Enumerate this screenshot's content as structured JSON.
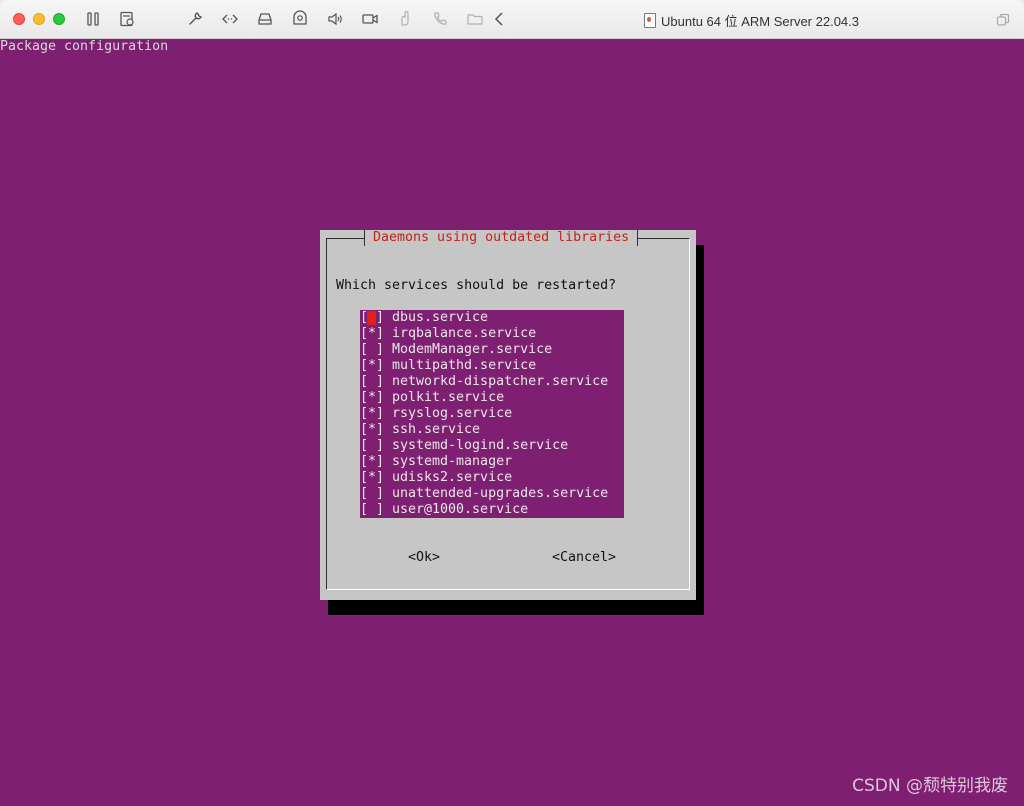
{
  "window": {
    "title": "Ubuntu 64 位 ARM Server 22.04.3"
  },
  "terminal": {
    "header": "Package configuration"
  },
  "dialog": {
    "title": "Daemons using outdated libraries",
    "question": "Which services should be restarted?",
    "services": [
      {
        "box": "[ ]",
        "label": "dbus.service",
        "checked": false,
        "cursor": true
      },
      {
        "box": "[*]",
        "label": "irqbalance.service",
        "checked": true
      },
      {
        "box": "[ ]",
        "label": "ModemManager.service",
        "checked": false
      },
      {
        "box": "[*]",
        "label": "multipathd.service",
        "checked": true
      },
      {
        "box": "[ ]",
        "label": "networkd-dispatcher.service",
        "checked": false
      },
      {
        "box": "[*]",
        "label": "polkit.service",
        "checked": true
      },
      {
        "box": "[*]",
        "label": "rsyslog.service",
        "checked": true
      },
      {
        "box": "[*]",
        "label": "ssh.service",
        "checked": true
      },
      {
        "box": "[ ]",
        "label": "systemd-logind.service",
        "checked": false
      },
      {
        "box": "[*]",
        "label": "systemd-manager",
        "checked": true
      },
      {
        "box": "[*]",
        "label": "udisks2.service",
        "checked": true
      },
      {
        "box": "[ ]",
        "label": "unattended-upgrades.service",
        "checked": false
      },
      {
        "box": "[ ]",
        "label": "user@1000.service",
        "checked": false
      }
    ],
    "ok_label": "<Ok>",
    "cancel_label": "<Cancel>"
  },
  "watermark": "CSDN @颓特别我废",
  "colors": {
    "terminal_bg": "#7e1f72",
    "dialog_bg": "#c6c6c6",
    "dialog_title": "#c4221a",
    "cursor": "#e0201a"
  },
  "toolbar_icons": [
    "pause-icon",
    "snapshot-icon",
    "settings-wrench-icon",
    "code-icon",
    "disk-icon",
    "camera-icon",
    "sound-icon",
    "video-icon",
    "usb-icon",
    "phone-icon",
    "shared-folder-icon",
    "back-chevron-icon"
  ]
}
